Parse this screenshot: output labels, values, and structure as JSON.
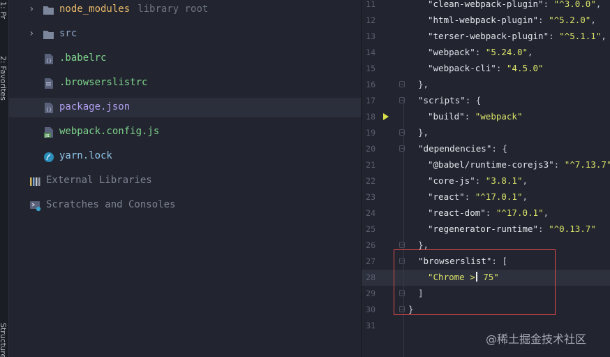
{
  "side_tabs": {
    "top": "1: Pr",
    "middle": "2: Favorites",
    "bottom": "Structure"
  },
  "tree": [
    {
      "label": "node_modules",
      "hint": "library root",
      "type": "folder",
      "expanded": false,
      "color": "#e8b86a"
    },
    {
      "label": "src",
      "type": "folder",
      "expanded": false,
      "color": "#8fa4c8"
    },
    {
      "label": ".babelrc",
      "type": "json-file",
      "color": "#7fd38c"
    },
    {
      "label": ".browserslistrc",
      "type": "text-file",
      "color": "#7fd38c"
    },
    {
      "label": "package.json",
      "type": "json-file",
      "color": "#b29ff0",
      "selected": true
    },
    {
      "label": "webpack.config.js",
      "type": "js-file",
      "color": "#7fd38c"
    },
    {
      "label": "yarn.lock",
      "type": "yarn-file",
      "color": "#8fc3e8"
    },
    {
      "label": "External Libraries",
      "type": "libraries",
      "color": "#7d8495"
    },
    {
      "label": "Scratches and Consoles",
      "type": "scratches",
      "color": "#7d8495"
    }
  ],
  "editor": {
    "lines": [
      {
        "n": "11",
        "key": "\"clean-webpack-plugin\"",
        "val": "\"^3.0.0\"",
        "end": ",",
        "indent": 2
      },
      {
        "n": "12",
        "key": "\"html-webpack-plugin\"",
        "val": "\"^5.2.0\"",
        "end": ",",
        "indent": 2
      },
      {
        "n": "13",
        "key": "\"terser-webpack-plugin\"",
        "val": "\"^5.1.1\"",
        "end": ",",
        "indent": 2
      },
      {
        "n": "14",
        "key": "\"webpack\"",
        "val": "\"5.24.0\"",
        "end": ",",
        "indent": 2
      },
      {
        "n": "15",
        "key": "\"webpack-cli\"",
        "val": "\"4.5.0\"",
        "end": "",
        "indent": 2
      },
      {
        "n": "16",
        "text": "},",
        "indent": 1,
        "fold": true
      },
      {
        "n": "17",
        "key": "\"scripts\"",
        "text2": ": {",
        "indent": 1,
        "fold": true
      },
      {
        "n": "18",
        "key": "\"build\"",
        "val": "\"webpack\"",
        "end": "",
        "indent": 2,
        "run": true
      },
      {
        "n": "19",
        "text": "},",
        "indent": 1,
        "fold": true
      },
      {
        "n": "20",
        "key": "\"dependencies\"",
        "text2": ": {",
        "indent": 1,
        "fold": true
      },
      {
        "n": "21",
        "key": "\"@babel/runtime-corejs3\"",
        "val": "\"^7.13.7\"",
        "end": ",",
        "indent": 2
      },
      {
        "n": "22",
        "key": "\"core-js\"",
        "val": "\"3.8.1\"",
        "end": ",",
        "indent": 2
      },
      {
        "n": "23",
        "key": "\"react\"",
        "val": "\"^17.0.1\"",
        "end": ",",
        "indent": 2
      },
      {
        "n": "24",
        "key": "\"react-dom\"",
        "val": "\"^17.0.1\"",
        "end": ",",
        "indent": 2
      },
      {
        "n": "25",
        "key": "\"regenerator-runtime\"",
        "val": "\"^0.13.7\"",
        "end": "",
        "indent": 2
      },
      {
        "n": "26",
        "text": "},",
        "indent": 1,
        "fold": true
      },
      {
        "n": "27",
        "key": "\"browserslist\"",
        "text2": ": [",
        "indent": 1,
        "fold": true
      },
      {
        "n": "28",
        "str_before": "\"Chrome >",
        "str_after": " 75\"",
        "indent": 2,
        "current": true,
        "caret": true
      },
      {
        "n": "29",
        "text": "]",
        "indent": 1,
        "fold": true
      },
      {
        "n": "30",
        "text": "}",
        "indent": 0,
        "fold": true
      },
      {
        "n": "31",
        "text": "",
        "indent": 0
      }
    ]
  },
  "watermark": "@稀土掘金技术社区",
  "colors": {
    "background": "#22252f",
    "string": "#dbe36a",
    "highlight_border": "#e04a4a"
  }
}
